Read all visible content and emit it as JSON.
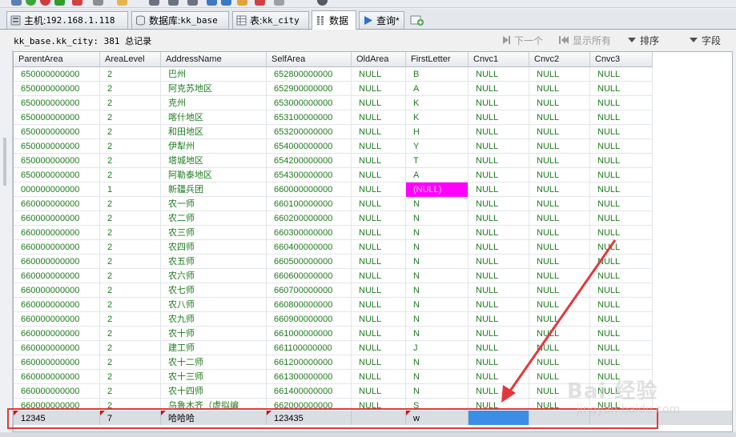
{
  "tabs": [
    {
      "prefix": "主机: ",
      "value": "192.168.1.118",
      "icon": "server-icon"
    },
    {
      "prefix": "数据库: ",
      "value": "kk_base",
      "icon": "database-icon"
    },
    {
      "prefix": "表: ",
      "value": "kk_city",
      "icon": "table-icon"
    },
    {
      "prefix": "数据",
      "value": "",
      "icon": "grid-icon",
      "active": true
    },
    {
      "prefix": "查询*",
      "value": "",
      "icon": "play-icon"
    }
  ],
  "infobar": {
    "record_info": "kk_base.kk_city: 381 总记录",
    "next_label": "下一个",
    "show_all_label": "显示所有",
    "sort_label": "排序",
    "fields_label": "字段"
  },
  "columns": [
    "ParentArea",
    "AreaLevel",
    "AddressName",
    "SelfArea",
    "OldArea",
    "FirstLetter",
    "Cnvc1",
    "Cnvc2",
    "Cnvc3"
  ],
  "rows": [
    [
      "650000000000",
      "2",
      "巴州",
      "652800000000",
      "NULL",
      "B",
      "NULL",
      "NULL",
      "NULL"
    ],
    [
      "650000000000",
      "2",
      "阿克苏地区",
      "652900000000",
      "NULL",
      "A",
      "NULL",
      "NULL",
      "NULL"
    ],
    [
      "650000000000",
      "2",
      "克州",
      "653000000000",
      "NULL",
      "K",
      "NULL",
      "NULL",
      "NULL"
    ],
    [
      "650000000000",
      "2",
      "喀什地区",
      "653100000000",
      "NULL",
      "K",
      "NULL",
      "NULL",
      "NULL"
    ],
    [
      "650000000000",
      "2",
      "和田地区",
      "653200000000",
      "NULL",
      "H",
      "NULL",
      "NULL",
      "NULL"
    ],
    [
      "650000000000",
      "2",
      "伊犁州",
      "654000000000",
      "NULL",
      "Y",
      "NULL",
      "NULL",
      "NULL"
    ],
    [
      "650000000000",
      "2",
      "塔城地区",
      "654200000000",
      "NULL",
      "T",
      "NULL",
      "NULL",
      "NULL"
    ],
    [
      "650000000000",
      "2",
      "阿勒泰地区",
      "654300000000",
      "NULL",
      "A",
      "NULL",
      "NULL",
      "NULL"
    ],
    [
      "000000000000",
      "1",
      "新疆兵团",
      "660000000000",
      "NULL",
      "(NULL)",
      "NULL",
      "NULL",
      "NULL"
    ],
    [
      "660000000000",
      "2",
      "农一师",
      "660100000000",
      "NULL",
      "N",
      "NULL",
      "NULL",
      "NULL"
    ],
    [
      "660000000000",
      "2",
      "农二师",
      "660200000000",
      "NULL",
      "N",
      "NULL",
      "NULL",
      "NULL"
    ],
    [
      "660000000000",
      "2",
      "农三师",
      "660300000000",
      "NULL",
      "N",
      "NULL",
      "NULL",
      "NULL"
    ],
    [
      "660000000000",
      "2",
      "农四师",
      "660400000000",
      "NULL",
      "N",
      "NULL",
      "NULL",
      "NULL"
    ],
    [
      "660000000000",
      "2",
      "农五师",
      "660500000000",
      "NULL",
      "N",
      "NULL",
      "NULL",
      "NULL"
    ],
    [
      "660000000000",
      "2",
      "农六师",
      "660600000000",
      "NULL",
      "N",
      "NULL",
      "NULL",
      "NULL"
    ],
    [
      "660000000000",
      "2",
      "农七师",
      "660700000000",
      "NULL",
      "N",
      "NULL",
      "NULL",
      "NULL"
    ],
    [
      "660000000000",
      "2",
      "农八师",
      "660800000000",
      "NULL",
      "N",
      "NULL",
      "NULL",
      "NULL"
    ],
    [
      "660000000000",
      "2",
      "农九师",
      "660900000000",
      "NULL",
      "N",
      "NULL",
      "NULL",
      "NULL"
    ],
    [
      "660000000000",
      "2",
      "农十师",
      "661000000000",
      "NULL",
      "N",
      "NULL",
      "NULL",
      "NULL"
    ],
    [
      "660000000000",
      "2",
      "建工师",
      "661100000000",
      "NULL",
      "J",
      "NULL",
      "NULL",
      "NULL"
    ],
    [
      "660000000000",
      "2",
      "农十二师",
      "661200000000",
      "NULL",
      "N",
      "NULL",
      "NULL",
      "NULL"
    ],
    [
      "660000000000",
      "2",
      "农十三师",
      "661300000000",
      "NULL",
      "N",
      "NULL",
      "NULL",
      "NULL"
    ],
    [
      "660000000000",
      "2",
      "农十四师",
      "661400000000",
      "NULL",
      "N",
      "NULL",
      "NULL",
      "NULL"
    ],
    [
      "660000000000",
      "2",
      "乌鲁木齐（虚拟编",
      "662000000000",
      "NULL",
      "S",
      "NULL",
      "NULL",
      "NULL"
    ]
  ],
  "highlight_cell": {
    "row": 8,
    "col": 5,
    "color": "#ff00ff"
  },
  "new_row": [
    "12345",
    "7",
    "哈哈哈",
    "123435",
    "",
    "w",
    "",
    "",
    ""
  ],
  "watermark": {
    "text": "Bai 经验",
    "sub": "jingyan.baidu.com"
  },
  "colors": {
    "cell_text": "#1e7b1e",
    "edit_cell": "#3a8ee6",
    "annotation": "#e3373a"
  }
}
